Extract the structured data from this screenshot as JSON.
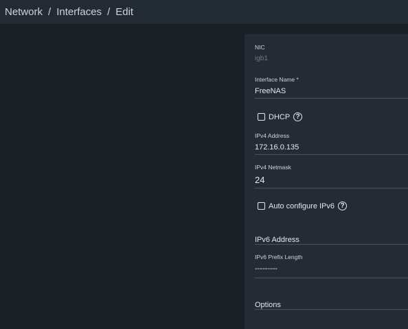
{
  "breadcrumb": {
    "items": [
      "Network",
      "Interfaces",
      "Edit"
    ],
    "separator": "/"
  },
  "form": {
    "nic": {
      "label": "NIC",
      "value": "igb1"
    },
    "interface_name": {
      "label": "Interface Name *",
      "value": "FreeNAS"
    },
    "dhcp": {
      "label": "DHCP",
      "checked": false,
      "help_icon": "question-circle-icon"
    },
    "ipv4_address": {
      "label": "IPv4 Address",
      "value": "172.16.0.135"
    },
    "ipv4_netmask": {
      "label": "IPv4 Netmask",
      "value": "24"
    },
    "auto_ipv6": {
      "label": "Auto configure IPv6",
      "checked": false,
      "help_icon": "question-circle-icon"
    },
    "ipv6_address": {
      "placeholder": "IPv6 Address"
    },
    "ipv6_prefix": {
      "label": "IPv6 Prefix Length",
      "value": "---------"
    },
    "options": {
      "placeholder": "Options"
    }
  },
  "colors": {
    "background": "#1b2027",
    "topbar": "#222a33",
    "panel": "#242b34",
    "text": "#e6e9ed",
    "muted": "#6f7782",
    "underline": "#4b535d"
  }
}
